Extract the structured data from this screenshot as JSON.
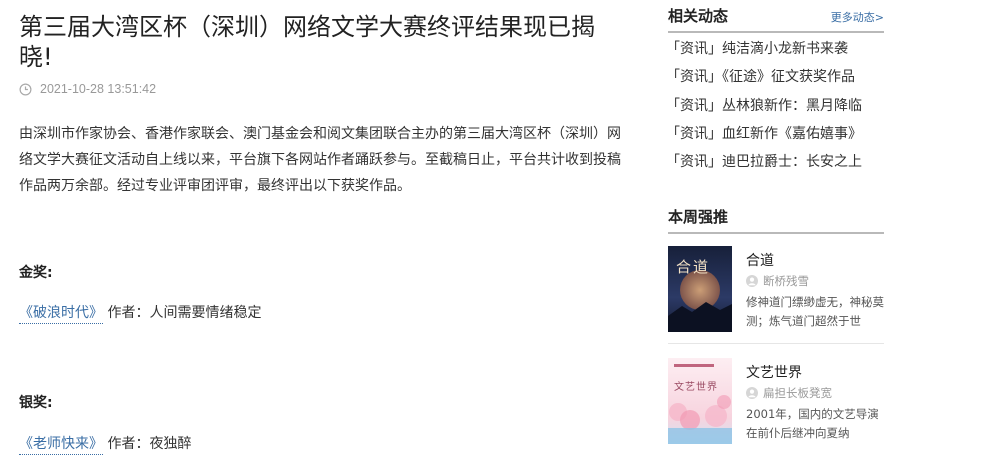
{
  "article": {
    "title": "第三届大湾区杯（深圳）网络文学大赛终评结果现已揭晓!",
    "datetime": "2021-10-28 13:51:42",
    "lead": "由深圳市作家协会、香港作家联会、澳门基金会和阅文集团联合主办的第三届大湾区杯（深圳）网络文学大赛征文活动自上线以来，平台旗下各网站作者踊跃参与。至截稿日止，平台共计收到投稿作品两万余部。经过专业评审团评审，最终评出以下获奖作品。",
    "awards": [
      {
        "heading": "金奖:",
        "book": "《破浪时代》",
        "author_prefix": "作者：",
        "author": "人间需要情绪稳定"
      },
      {
        "heading": "银奖:",
        "book": "《老师快来》",
        "author_prefix": "作者：",
        "author": "夜独醉"
      }
    ]
  },
  "sidebar": {
    "related": {
      "title": "相关动态",
      "more_label": "更多动态>",
      "items": [
        "「资讯」纯洁滴小龙新书来袭",
        "「资讯」《征途》征文获奖作品",
        "「资讯」丛林狼新作：黑月降临",
        "「资讯」血红新作《嘉佑嬉事》",
        "「资讯」迪巴拉爵士：长安之上"
      ]
    },
    "weekly": {
      "title": "本周强推",
      "books": [
        {
          "name": "合道",
          "author": "断桥残雪",
          "desc": "修神道门缥缈虚无，神秘莫测；炼气道门超然于世",
          "cover_title": "合道",
          "cover_colors": [
            "#17203a",
            "#2c3a66",
            "#c2855a"
          ]
        },
        {
          "name": "文艺世界",
          "author": "扁担长板凳宽",
          "desc": "2001年，国内的文艺导演在前仆后继冲向夏纳",
          "cover_title": "文艺世界",
          "cover_colors": [
            "#fdeef2",
            "#f5b6c9",
            "#8ec3e6"
          ]
        }
      ]
    }
  }
}
